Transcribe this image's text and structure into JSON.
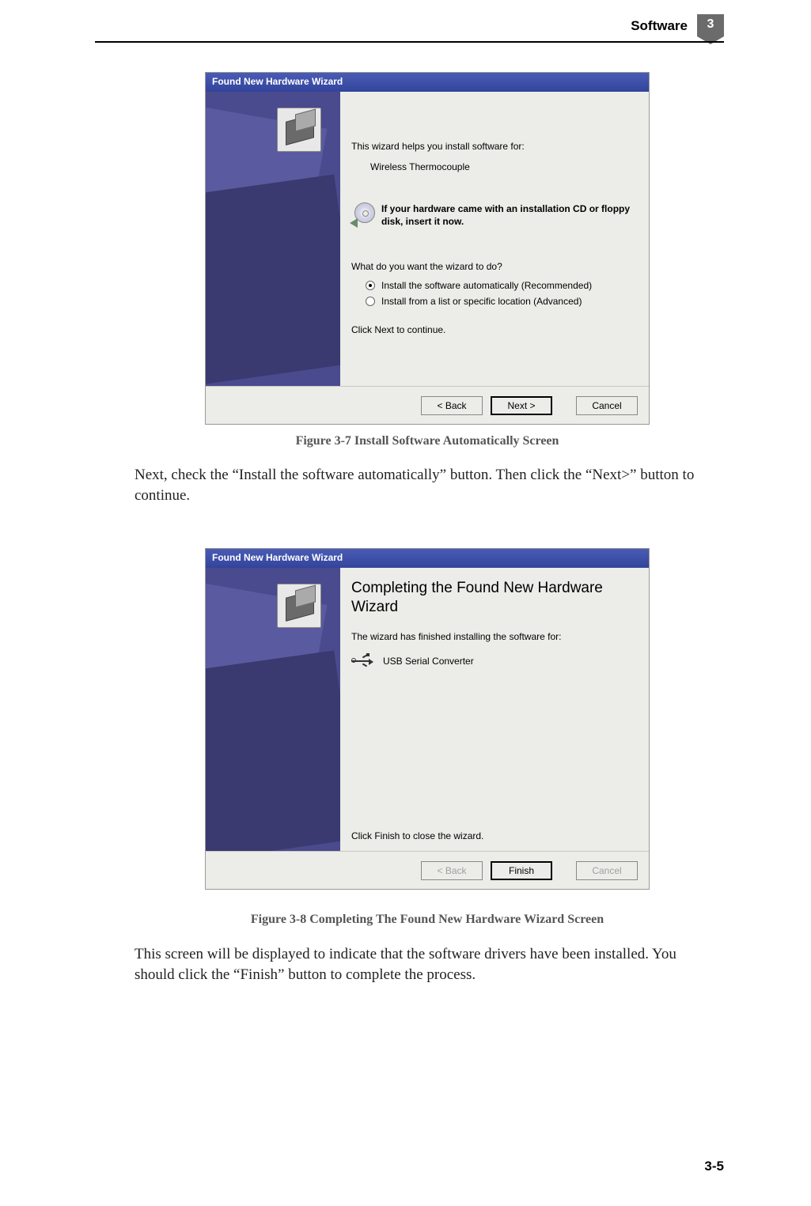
{
  "page": {
    "header_label": "Software",
    "chapter_num": "3",
    "footer_page": "3-5"
  },
  "wizard1": {
    "title": "Found New Hardware Wizard",
    "intro": "This wizard helps you install software for:",
    "device": "Wireless Thermocouple",
    "cd_hint": "If your hardware came with an installation CD or floppy disk, insert it now.",
    "question": "What do you want the wizard to do?",
    "opt_auto": "Install the software automatically (Recommended)",
    "opt_list": "Install from a list or specific location (Advanced)",
    "click_next": "Click Next to continue.",
    "btn_back": "< Back",
    "btn_next": "Next >",
    "btn_cancel": "Cancel"
  },
  "caption1": "Figure 3-7  Install Software Automatically Screen",
  "para1": "Next, check the “Install the software automatically” button. Then click the “Next>” button to continue.",
  "wizard2": {
    "title": "Found New Hardware Wizard",
    "heading": "Completing the Found New Hardware Wizard",
    "sub": "The wizard has finished installing the software for:",
    "device": "USB Serial Converter",
    "click_finish": "Click Finish to close the wizard.",
    "btn_back": "< Back",
    "btn_finish": "Finish",
    "btn_cancel": "Cancel"
  },
  "caption2": "Figure 3-8  Completing The Found New Hardware Wizard Screen",
  "para2": "This screen will be displayed to indicate that the software drivers have been installed. You should click the “Finish” button to complete the process."
}
